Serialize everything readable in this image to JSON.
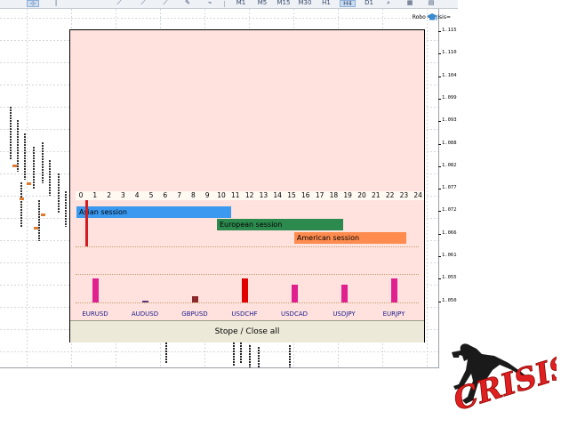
{
  "toolbar": {
    "timeframes": [
      "M1",
      "M5",
      "M15",
      "M30",
      "H1",
      "H4",
      "D1"
    ],
    "selected_timeframe": "H4"
  },
  "chart": {
    "ea_title": "Robo =Crisis=",
    "price_labels": [
      "1.115",
      "1.110",
      "1.104",
      "1.099",
      "1.093",
      "1.088",
      "1.082",
      "1.077",
      "1.072",
      "1.066",
      "1.061",
      "1.055",
      "1.050"
    ]
  },
  "panel": {
    "hours": [
      "0",
      "1",
      "2",
      "3",
      "4",
      "5",
      "6",
      "7",
      "8",
      "9",
      "10",
      "11",
      "12",
      "13",
      "14",
      "15",
      "16",
      "17",
      "18",
      "19",
      "20",
      "21",
      "22",
      "23",
      "24"
    ],
    "sessions": [
      {
        "label": "Asian session",
        "start": 0,
        "end": 11,
        "color": "#3b99ef"
      },
      {
        "label": "European session",
        "start": 10,
        "end": 19,
        "color": "#2d8a4e"
      },
      {
        "label": "American session",
        "start": 15.5,
        "end": 23.5,
        "color": "#ff8b4f"
      }
    ],
    "current_hour": 0.7,
    "symbols": [
      {
        "name": "EURUSD",
        "strength": 0.8,
        "color": "#e0208f"
      },
      {
        "name": "AUDUSD",
        "strength": 0.05,
        "color": "#5a3b7a"
      },
      {
        "name": "GBPUSD",
        "strength": 0.22,
        "color": "#8a2a2a"
      },
      {
        "name": "USDCHF",
        "strength": 0.8,
        "color": "#e00000"
      },
      {
        "name": "USDCAD",
        "strength": 0.58,
        "color": "#e0208f"
      },
      {
        "name": "USDJPY",
        "strength": 0.58,
        "color": "#e0208f"
      },
      {
        "name": "EURJPY",
        "strength": 0.8,
        "color": "#e0208f"
      }
    ],
    "stop_label": "Stope / Close all"
  },
  "logo": {
    "text": "CRISIS"
  }
}
